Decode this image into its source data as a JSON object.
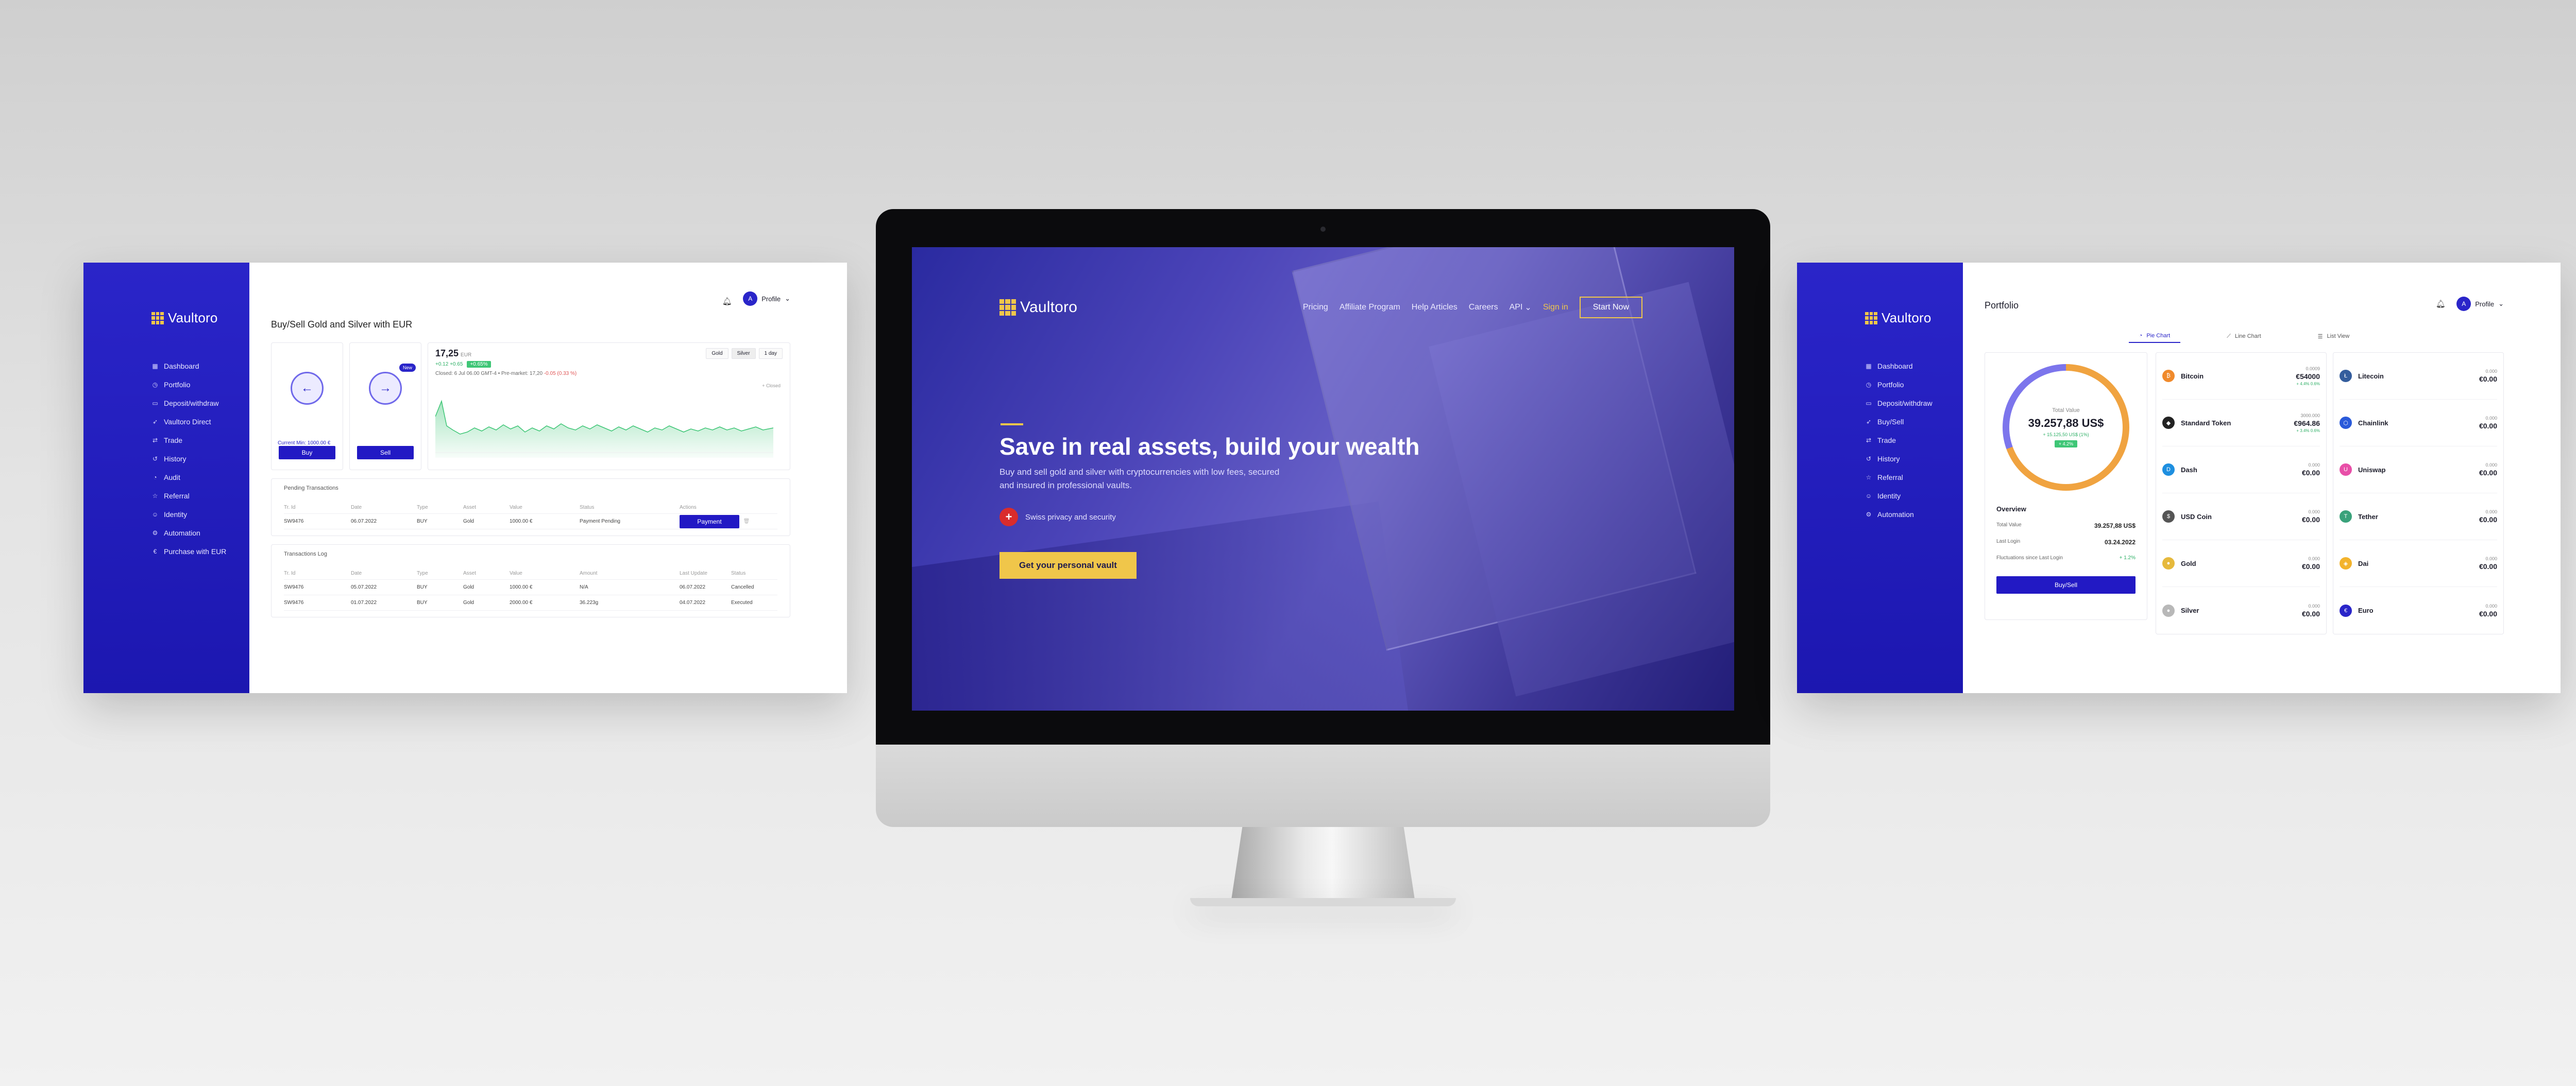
{
  "brand": {
    "name": "Vaultoro",
    "accent": "#2a25c9",
    "gold": "#f0c64a"
  },
  "left_panel": {
    "sidebar": {
      "items": [
        {
          "icon": "grid-icon",
          "label": "Dashboard"
        },
        {
          "icon": "clock-icon",
          "label": "Portfolio"
        },
        {
          "icon": "card-icon",
          "label": "Deposit/withdraw"
        },
        {
          "icon": "send-icon",
          "label": "Vaultoro Direct"
        },
        {
          "icon": "swap-icon",
          "label": "Trade"
        },
        {
          "icon": "history-icon",
          "label": "History"
        },
        {
          "icon": "pie-icon",
          "label": "Audit"
        },
        {
          "icon": "star-icon",
          "label": "Referral"
        },
        {
          "icon": "user-icon",
          "label": "Identity"
        },
        {
          "icon": "gear-icon",
          "label": "Automation"
        },
        {
          "icon": "euro-icon",
          "label": "Purchase with EUR"
        }
      ]
    },
    "header": {
      "profile_label": "Profile",
      "avatar_letter": "A"
    },
    "title": "Buy/Sell Gold and Silver with EUR",
    "trade": {
      "buy_note": "Current Min: 1000.00 €",
      "buy_label": "Buy",
      "sell_label": "Sell",
      "new_badge": "New"
    },
    "chart": {
      "price": "17,25",
      "unit": "EUR",
      "change": "+0.12 +0.65",
      "change_badge": "+0.65%",
      "meta": "Closed: 6 Jul 06.00 GMT-4",
      "meta_premarket": "Pre-market: 17,20",
      "meta_delta": "-0.05 (0.33 %)",
      "tabs": [
        "Gold",
        "Silver",
        "1 day"
      ],
      "active_tab": "Silver",
      "legend_note": "+ Closed",
      "color": "#3ec676"
    },
    "pending": {
      "title": "Pending Transactions",
      "headers": [
        "Tr. Id",
        "Date",
        "Type",
        "Asset",
        "Value",
        "Status",
        "Actions"
      ],
      "rows": [
        {
          "id": "SW9476",
          "date": "06.07.2022",
          "type": "BUY",
          "asset": "Gold",
          "value": "1000.00 €",
          "status": "Payment Pending",
          "action": "Payment"
        }
      ]
    },
    "log": {
      "title": "Transactions Log",
      "headers": [
        "Tr. Id",
        "Date",
        "Type",
        "Asset",
        "Value",
        "Amount",
        "Last Update",
        "Status"
      ],
      "rows": [
        {
          "id": "SW9476",
          "date": "05.07.2022",
          "type": "BUY",
          "asset": "Gold",
          "value": "1000.00 €",
          "amount": "N/A",
          "updated": "06.07.2022",
          "status": "Cancelled"
        },
        {
          "id": "SW9476",
          "date": "01.07.2022",
          "type": "BUY",
          "asset": "Gold",
          "value": "2000.00 €",
          "amount": "36.223g",
          "updated": "04.07.2022",
          "status": "Executed"
        }
      ]
    }
  },
  "center": {
    "nav": {
      "links": [
        "Pricing",
        "Affiliate Program",
        "Help Articles",
        "Careers",
        "API"
      ],
      "signin": "Sign in",
      "start": "Start Now"
    },
    "hero": {
      "title": "Save in real assets, build your wealth",
      "subtitle": "Buy and sell gold and silver with cryptocurrencies with low fees, secured and insured in professional vaults.",
      "swiss": "Swiss privacy and security",
      "cta": "Get your personal vault"
    }
  },
  "right_panel": {
    "sidebar": {
      "items": [
        {
          "icon": "grid-icon",
          "label": "Dashboard"
        },
        {
          "icon": "clock-icon",
          "label": "Portfolio"
        },
        {
          "icon": "card-icon",
          "label": "Deposit/withdraw"
        },
        {
          "icon": "send-icon",
          "label": "Buy/Sell"
        },
        {
          "icon": "swap-icon",
          "label": "Trade"
        },
        {
          "icon": "history-icon",
          "label": "History"
        },
        {
          "icon": "star-icon",
          "label": "Referral"
        },
        {
          "icon": "user-icon",
          "label": "Identity"
        },
        {
          "icon": "gear-icon",
          "label": "Automation"
        }
      ]
    },
    "header": {
      "title": "Portfolio",
      "profile_label": "Profile",
      "avatar_letter": "A"
    },
    "tabs": [
      {
        "icon": "pie-icon",
        "label": "Pie Chart",
        "active": true
      },
      {
        "icon": "line-icon",
        "label": "Line Chart",
        "active": false
      },
      {
        "icon": "list-icon",
        "label": "List View",
        "active": false
      }
    ],
    "total": {
      "label": "Total Value",
      "value": "39.257,88 US$",
      "change": "+ 15.125,50 US$ (1%)",
      "badge": "+ 4.2%"
    },
    "overview": {
      "title": "Overview",
      "rows": [
        {
          "label": "Total Value",
          "value": "39.257,88 US$"
        },
        {
          "label": "Last Login",
          "value": "03.24.2022"
        },
        {
          "label": "Fluctuations since Last Login",
          "value": "+ 1.2%"
        }
      ],
      "button": "Buy/Sell"
    },
    "assets_left": [
      {
        "name": "Bitcoin",
        "icon": "bitcoin-icon",
        "glyph": "₿",
        "color": "#f08a2c",
        "amount": "0.0009",
        "eur": "€54000",
        "chg": "+ 4.4% 0.6%"
      },
      {
        "name": "Standard Token",
        "icon": "token-icon",
        "glyph": "◆",
        "color": "#222222",
        "amount": "3000.000",
        "eur": "€964.86",
        "chg": "+ 3.4% 0.6%"
      },
      {
        "name": "Dash",
        "icon": "dash-icon",
        "glyph": "D",
        "color": "#1e8fe0",
        "amount": "0.000",
        "eur": "€0.00",
        "chg": ""
      },
      {
        "name": "USD Coin",
        "icon": "usdc-icon",
        "glyph": "$",
        "color": "#555555",
        "amount": "0.000",
        "eur": "€0.00",
        "chg": ""
      },
      {
        "name": "Gold",
        "icon": "gold-icon",
        "glyph": "●",
        "color": "#e6b93c",
        "amount": "0.000",
        "eur": "€0.00",
        "chg": ""
      },
      {
        "name": "Silver",
        "icon": "silver-icon",
        "glyph": "●",
        "color": "#b8b8b8",
        "amount": "0.000",
        "eur": "€0.00",
        "chg": ""
      }
    ],
    "assets_right": [
      {
        "name": "Litecoin",
        "icon": "litecoin-icon",
        "glyph": "Ł",
        "color": "#345d9d",
        "amount": "0.000",
        "eur": "€0.00",
        "chg": ""
      },
      {
        "name": "Chainlink",
        "icon": "chainlink-icon",
        "glyph": "⬡",
        "color": "#2a5ada",
        "amount": "0.000",
        "eur": "€0.00",
        "chg": ""
      },
      {
        "name": "Uniswap",
        "icon": "uniswap-icon",
        "glyph": "U",
        "color": "#e84fa8",
        "amount": "0.000",
        "eur": "€0.00",
        "chg": ""
      },
      {
        "name": "Tether",
        "icon": "tether-icon",
        "glyph": "T",
        "color": "#3aa27b",
        "amount": "0.000",
        "eur": "€0.00",
        "chg": ""
      },
      {
        "name": "Dai",
        "icon": "dai-icon",
        "glyph": "◈",
        "color": "#f3b32c",
        "amount": "0.000",
        "eur": "€0.00",
        "chg": ""
      },
      {
        "name": "Euro",
        "icon": "euro-icon",
        "glyph": "€",
        "color": "#2a25c9",
        "amount": "0.000",
        "eur": "€0.00",
        "chg": ""
      }
    ]
  }
}
